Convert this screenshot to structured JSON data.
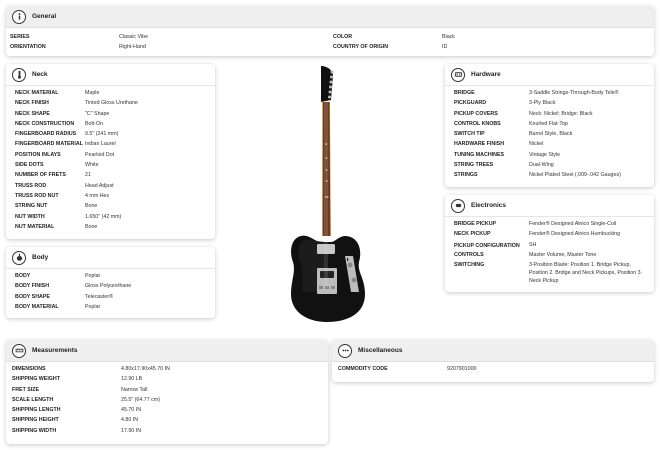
{
  "general": {
    "title": "General",
    "rows": [
      {
        "k": "SERIES",
        "v": "Classic Vibe",
        "k2": "COLOR",
        "v2": "Black"
      },
      {
        "k": "ORIENTATION",
        "v": "Right-Hand",
        "k2": "COUNTRY OF ORIGIN",
        "v2": "ID"
      }
    ]
  },
  "neck": {
    "title": "Neck",
    "rows": [
      {
        "k": "NECK MATERIAL",
        "v": "Maple"
      },
      {
        "k": "NECK FINISH",
        "v": "Tinted Gloss Urethane"
      },
      {
        "k": "NECK SHAPE",
        "v": "\"C\" Shape"
      },
      {
        "k": "NECK CONSTRUCTION",
        "v": "Bolt-On"
      },
      {
        "k": "FINGERBOARD RADIUS",
        "v": "9.5\" (241 mm)"
      },
      {
        "k": "FINGERBOARD MATERIAL",
        "v": "Indian Laurel"
      },
      {
        "k": "POSITION INLAYS",
        "v": "Pearloid Dot"
      },
      {
        "k": "SIDE DOTS",
        "v": "White"
      },
      {
        "k": "NUMBER OF FRETS",
        "v": "21"
      },
      {
        "k": "TRUSS ROD",
        "v": "Head Adjust"
      },
      {
        "k": "TRUSS ROD NUT",
        "v": "4 mm Hex"
      },
      {
        "k": "STRING NUT",
        "v": "Bone"
      },
      {
        "k": "NUT WIDTH",
        "v": "1.650\" (42 mm)"
      },
      {
        "k": "NUT MATERIAL",
        "v": "Bone"
      }
    ]
  },
  "body": {
    "title": "Body",
    "rows": [
      {
        "k": "BODY",
        "v": "Poplar"
      },
      {
        "k": "BODY FINISH",
        "v": "Gloss Polyurethane"
      },
      {
        "k": "BODY SHAPE",
        "v": "Telecaster®"
      },
      {
        "k": "BODY MATERIAL",
        "v": "Poplar"
      }
    ]
  },
  "hardware": {
    "title": "Hardware",
    "rows": [
      {
        "k": "BRIDGE",
        "v": "3-Saddle Strings-Through-Body Tele®"
      },
      {
        "k": "PICKGUARD",
        "v": "3-Ply Black"
      },
      {
        "k": "PICKUP COVERS",
        "v": "Neck: Nickel; Bridge: Black"
      },
      {
        "k": "CONTROL KNOBS",
        "v": "Knurled Flat-Top"
      },
      {
        "k": "SWITCH TIP",
        "v": "Barrel Style, Black"
      },
      {
        "k": "HARDWARE FINISH",
        "v": "Nickel"
      },
      {
        "k": "TUNING MACHINES",
        "v": "Vintage Style"
      },
      {
        "k": "STRING TREES",
        "v": "Dual-Wing"
      },
      {
        "k": "STRINGS",
        "v": "Nickel Plated Steel (.009-.042 Gauges)"
      }
    ]
  },
  "electronics": {
    "title": "Electronics",
    "rows": [
      {
        "k": "BRIDGE PICKUP",
        "v": "Fender® Designed Alnico Single-Coil"
      },
      {
        "k": "NECK PICKUP",
        "v": "Fender® Designed Alnico Humbucking"
      },
      {
        "k": "PICKUP CONFIGURATION",
        "v": "SH"
      },
      {
        "k": "CONTROLS",
        "v": "Master Volume, Master Tone"
      },
      {
        "k": "SWITCHING",
        "v": "3-Position Blade: Position 1. Bridge Pickup, Position 2. Bridge and Neck Pickups, Position 3. Neck Pickup"
      }
    ]
  },
  "measurements": {
    "title": "Measurements",
    "rows": [
      {
        "k": "DIMENSIONS",
        "v": "4.80x17.90x45.70 IN"
      },
      {
        "k": "SHIPPING WEIGHT",
        "v": "12.90 LB"
      },
      {
        "k": "FRET SIZE",
        "v": "Narrow Tall"
      },
      {
        "k": "SCALE LENGTH",
        "v": "25.5\" (64.77 cm)"
      },
      {
        "k": "SHIPPING LENGTH",
        "v": "45.70 IN"
      },
      {
        "k": "SHIPPING HEIGHT",
        "v": "4.80 IN"
      },
      {
        "k": "SHIPPING WIDTH",
        "v": "17.90 IN"
      }
    ]
  },
  "misc": {
    "title": "Miscellaneous",
    "rows": [
      {
        "k": "COMMODITY CODE",
        "v": "9207901000"
      }
    ]
  },
  "icons": {
    "general": "info-icon",
    "neck": "guitar-neck-icon",
    "body": "guitar-body-icon",
    "hardware": "bridge-icon",
    "electronics": "pickup-icon",
    "measurements": "ruler-icon",
    "misc": "dots-icon"
  },
  "colors": {
    "header_grey": "#efefef",
    "guitar_body": "#111111",
    "fingerboard": "#6b3b22",
    "neck_maple": "#d9a864"
  }
}
